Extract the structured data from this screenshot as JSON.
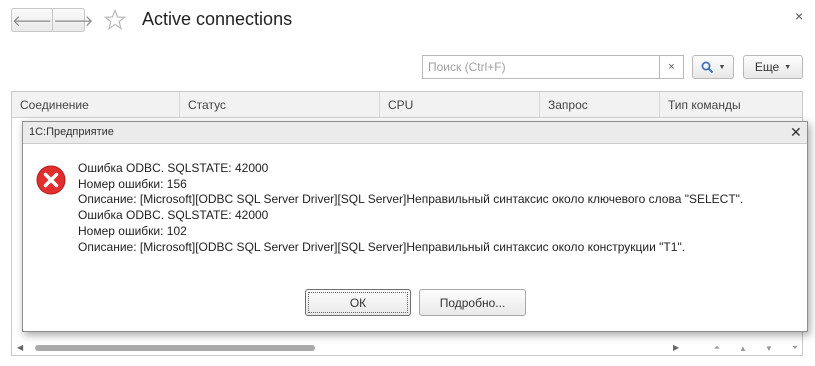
{
  "window": {
    "title": "Active connections",
    "close_glyph": "×",
    "nav": {
      "back_glyph": "🡐",
      "forward_glyph": "🡒"
    }
  },
  "toolbar": {
    "search_placeholder": "Поиск (Ctrl+F)",
    "clear_glyph": "×",
    "more_label": "Еще"
  },
  "table": {
    "columns": [
      "Соединение",
      "Статус",
      "CPU",
      "Запрос",
      "Тип команды"
    ]
  },
  "dialog": {
    "title": "1С:Предприятие",
    "close_glyph": "✕",
    "lines": [
      "Ошибка ODBC. SQLSTATE: 42000",
      "Номер ошибки: 156",
      "Описание: [Microsoft][ODBC SQL Server Driver][SQL Server]Неправильный синтаксис около ключевого слова \"SELECT\".",
      "Ошибка ODBC. SQLSTATE: 42000",
      "Номер ошибки: 102",
      "Описание: [Microsoft][ODBC SQL Server Driver][SQL Server]Неправильный синтаксис около конструкции \"T1\"."
    ],
    "ok_label": "ОК",
    "details_label": "Подробно..."
  },
  "icons": {
    "error": "error-icon",
    "star": "star-icon",
    "search": "search-icon"
  },
  "colors": {
    "error_red": "#e0302e",
    "search_blue": "#3a6fb5"
  }
}
